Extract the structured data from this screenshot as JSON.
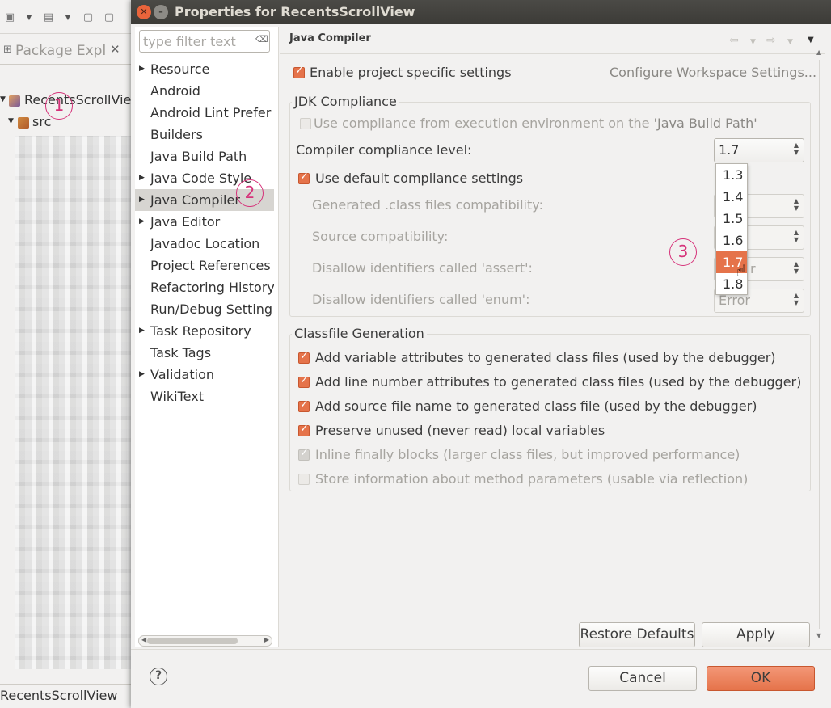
{
  "ide": {
    "package_explorer_tab": "Package Expl",
    "project_name": "RecentsScrollView",
    "src_folder": "src",
    "status_text": "RecentsScrollView"
  },
  "annotations": [
    "1",
    "2",
    "3"
  ],
  "dialog": {
    "title": "Properties for RecentsScrollView",
    "filter_placeholder": "type filter text",
    "nav_items": [
      {
        "label": "Resource",
        "expandable": true
      },
      {
        "label": "Android",
        "expandable": false
      },
      {
        "label": "Android Lint Prefer",
        "expandable": false
      },
      {
        "label": "Builders",
        "expandable": false
      },
      {
        "label": "Java Build Path",
        "expandable": false
      },
      {
        "label": "Java Code Style",
        "expandable": true
      },
      {
        "label": "Java Compiler",
        "expandable": true,
        "selected": true
      },
      {
        "label": "Java Editor",
        "expandable": true
      },
      {
        "label": "Javadoc Location",
        "expandable": false
      },
      {
        "label": "Project References",
        "expandable": false
      },
      {
        "label": "Refactoring History",
        "expandable": false
      },
      {
        "label": "Run/Debug Setting",
        "expandable": false
      },
      {
        "label": "Task Repository",
        "expandable": true
      },
      {
        "label": "Task Tags",
        "expandable": false
      },
      {
        "label": "Validation",
        "expandable": true
      },
      {
        "label": "WikiText",
        "expandable": false
      }
    ],
    "page_title": "Java Compiler",
    "enable_specific": "Enable project specific settings",
    "configure_link": "Configure Workspace Settings...",
    "jdk_group": {
      "label": "JDK Compliance",
      "use_compliance_prefix": "Use compliance from execution environment on the ",
      "use_compliance_link": "'Java Build Path'",
      "compliance_level_label": "Compiler compliance level:",
      "compliance_level_value": "1.7",
      "use_default": "Use default compliance settings",
      "generated_label": "Generated .class files compatibility:",
      "source_label": "Source compatibility:",
      "assert_label": "Disallow identifiers called 'assert':",
      "enum_label": "Disallow identifiers called 'enum':",
      "enum_value": "Error",
      "assert_value_partial": "r"
    },
    "dropdown_options": [
      "1.3",
      "1.4",
      "1.5",
      "1.6",
      "1.7",
      "1.8"
    ],
    "dropdown_highlighted": "1.7",
    "classfile_group": {
      "label": "Classfile Generation",
      "options": [
        {
          "label": "Add variable attributes to generated class files (used by the debugger)",
          "state": "on"
        },
        {
          "label": "Add line number attributes to generated class files (used by the debugger)",
          "state": "on"
        },
        {
          "label": "Add source file name to generated class file (used by the debugger)",
          "state": "on"
        },
        {
          "label": "Preserve unused (never read) local variables",
          "state": "on"
        },
        {
          "label": "Inline finally blocks (larger class files, but improved performance)",
          "state": "dis-on"
        },
        {
          "label": "Store information about method parameters (usable via reflection)",
          "state": "dis-off"
        }
      ]
    },
    "restore_defaults": "Restore Defaults",
    "apply": "Apply",
    "cancel": "Cancel",
    "ok": "OK",
    "help_icon": "?"
  },
  "colors": {
    "accent": "#e5734a",
    "annotation": "#d6337a",
    "titlebar": "#3c3b37"
  }
}
